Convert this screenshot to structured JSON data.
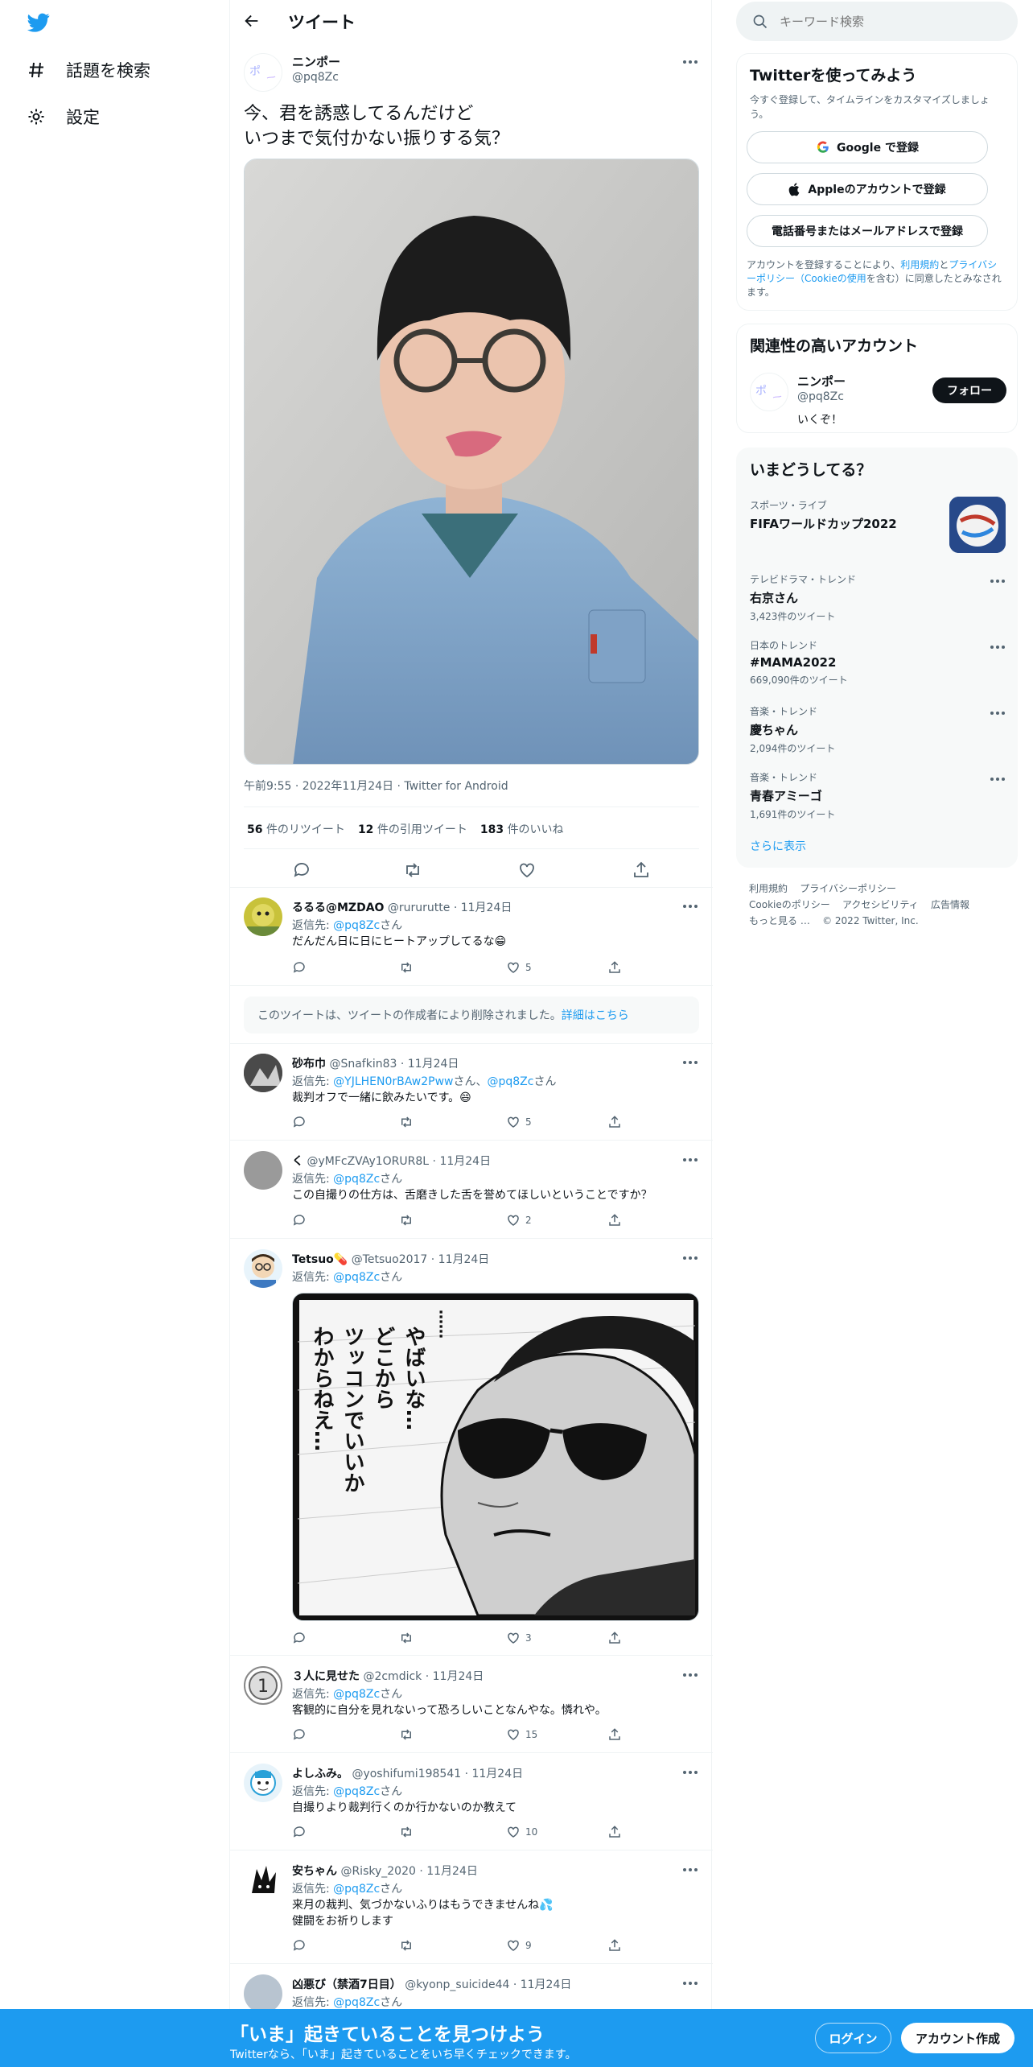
{
  "colors": {
    "accent": "#1d9bf0",
    "text": "#0f1419",
    "muted": "#536471"
  },
  "leftnav": {
    "items": [
      {
        "icon": "hashtag-icon",
        "label": "話題を検索"
      },
      {
        "icon": "gear-icon",
        "label": "設定"
      }
    ]
  },
  "header": {
    "title": "ツイート"
  },
  "tweet": {
    "name": "ニンポー",
    "handle": "@pq8Zc",
    "text_line1": "今、君を誘惑してるんだけど",
    "text_line2": "いつまで気付かない振りする気？",
    "meta": "午前9:55 · 2022年11月24日 · Twitter for Android",
    "retweets_count": "56",
    "retweets_label": "件のリツイート",
    "quotes_count": "12",
    "quotes_label": "件の引用ツイート",
    "likes_count": "183",
    "likes_label": "件のいいね"
  },
  "replies": [
    {
      "name": "るるる@MZDAO",
      "handle": "@rururutte · 11月24日",
      "to_prefix": "返信先: ",
      "to": "@pq8Zc",
      "to_suffix": "さん",
      "text": "だんだん日に日にヒートアップしてるな😁",
      "likes": "5"
    },
    {
      "deleted_text": "このツイートは、ツイートの作成者により削除されました。",
      "deleted_link": "詳細はこちら"
    },
    {
      "name": "砂布巾",
      "handle": "@Snafkin83 · 11月24日",
      "to_prefix": "返信先: ",
      "to": "@YJLHEN0rBAw2Pww",
      "to_mid": "さん、",
      "to2": "@pq8Zc",
      "to_suffix": "さん",
      "text": "裁判オフで一緒に飲みたいです。😄",
      "likes": "5"
    },
    {
      "name": "く",
      "handle": "@yMFcZVAy1ORUR8L · 11月24日",
      "to_prefix": "返信先: ",
      "to": "@pq8Zc",
      "to_suffix": "さん",
      "text": "この自撮りの仕方は、舌磨きした舌を誉めてほしいということですか？",
      "likes": "2"
    },
    {
      "name": "Tetsuo💊",
      "handle": "@Tetsuo2017 · 11月24日",
      "to_prefix": "返信先: ",
      "to": "@pq8Zc",
      "to_suffix": "さん",
      "manga_text_1": "やばいな…",
      "manga_text_2": "どこから",
      "manga_text_3": "ツッコンでいいか",
      "manga_text_4": "わからねえ…",
      "manga_text_5": "……",
      "likes": "3"
    },
    {
      "name": "３人に見せた",
      "handle": "@2cmdick · 11月24日",
      "to_prefix": "返信先: ",
      "to": "@pq8Zc",
      "to_suffix": "さん",
      "text": "客観的に自分を見れないって恐ろしいことなんやな。憐れや。",
      "likes": "15"
    },
    {
      "name": "よしふみ。",
      "handle": "@yoshifumi198541 · 11月24日",
      "to_prefix": "返信先: ",
      "to": "@pq8Zc",
      "to_suffix": "さん",
      "text": "自撮りより裁判行くのか行かないのか教えて",
      "likes": "10"
    },
    {
      "name": "安ちゃん",
      "handle": "@Risky_2020 · 11月24日",
      "to_prefix": "返信先: ",
      "to": "@pq8Zc",
      "to_suffix": "さん",
      "text": "来月の裁判、気づかないふりはもうできませんね💦",
      "text2": "健闘をお祈りします",
      "likes": "9"
    },
    {
      "name": "凶悪び（禁酒7日目）",
      "handle": "@kyonp_suicide44 · 11月24日",
      "to_prefix": "返信先: ",
      "to": "@pq8Zc",
      "to_suffix": "さん"
    }
  ],
  "right": {
    "search_placeholder": "キーワード検索",
    "signup_card": {
      "title": "Twitterを使ってみよう",
      "subtitle": "今すぐ登録して、タイムラインをカスタマイズしましょう。",
      "google": "Google で登録",
      "apple": "Appleのアカウントで登録",
      "phone": "電話番号またはメールアドレスで登録",
      "terms_1": "アカウントを登録することにより、",
      "terms_link1": "利用規約",
      "terms_2": "と",
      "terms_link2": "プライバシーポリシー（Cookieの使用",
      "terms_3": "を含む）に同意したとみなされます。"
    },
    "related": {
      "title": "関連性の高いアカウント",
      "name": "ニンポー",
      "handle": "@pq8Zc",
      "bio": "いくぞ！",
      "follow": "フォロー"
    },
    "trends": {
      "title": "いまどうしてる？",
      "items": [
        {
          "cat": "スポーツ・ライブ",
          "name": "FIFAワールドカップ2022",
          "count": ""
        },
        {
          "cat": "テレビドラマ・トレンド",
          "name": "右京さん",
          "count": "3,423件のツイート"
        },
        {
          "cat": "日本のトレンド",
          "name": "#MAMA2022",
          "count": "669,090件のツイート"
        },
        {
          "cat": "音楽・トレンド",
          "name": "慶ちゃん",
          "count": "2,094件のツイート"
        },
        {
          "cat": "音楽・トレンド",
          "name": "青春アミーゴ",
          "count": "1,691件のツイート"
        }
      ],
      "show_more": "さらに表示"
    },
    "footer": {
      "l1": "利用規約",
      "l2": "プライバシーポリシー",
      "l3": "Cookieのポリシー",
      "l4": "アクセシビリティ",
      "l5": "広告情報",
      "l6": "もっと見る …",
      "copyright": "© 2022 Twitter, Inc."
    }
  },
  "bottombar": {
    "headline": "「いま」起きていることを見つけよう",
    "sub": "Twitterなら、「いま」起きていることをいち早くチェックできます。",
    "login": "ログイン",
    "signup": "アカウント作成"
  }
}
